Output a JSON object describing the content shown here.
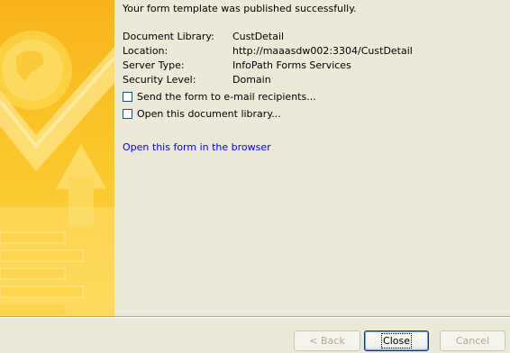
{
  "message": "Your form template was published successfully.",
  "details": [
    {
      "label": "Document Library:",
      "value": "CustDetail"
    },
    {
      "label": "Location:",
      "value": "http://maaasdw002:3304/CustDetail"
    },
    {
      "label": "Server Type:",
      "value": "InfoPath Forms Services"
    },
    {
      "label": "Security Level:",
      "value": "Domain"
    }
  ],
  "options": [
    {
      "label": "Send the form to e-mail recipients...",
      "checked": false
    },
    {
      "label": "Open this document library...",
      "checked": false
    }
  ],
  "open_link": "Open this form in the browser",
  "buttons": {
    "back": "< Back",
    "close": "Close",
    "cancel": "Cancel"
  },
  "colors": {
    "banner_orange": "#f7b41a",
    "link": "#0000ff",
    "dialog_bg": "#ece9d8"
  }
}
